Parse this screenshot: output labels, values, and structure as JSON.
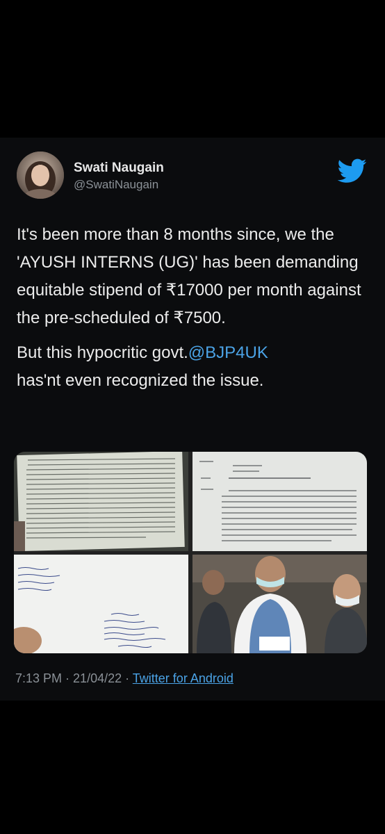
{
  "user": {
    "display_name": "Swati Naugain",
    "handle": "@SwatiNaugain",
    "avatar_icon": "profile-photo"
  },
  "tweet": {
    "paragraph_1": "It's been more than 8 months since, we the 'AYUSH INTERNS (UG)' has been demanding equitable stipend of ₹17000 per month against the pre-scheduled of ₹7500.",
    "paragraph_2_prefix": "But this hypocritic govt.",
    "mention": "@BJP4UK",
    "paragraph_2_suffix": "has'nt even recognized the issue."
  },
  "media": [
    {
      "name": "photo-hindi-letter-page",
      "kind": "document-photo"
    },
    {
      "name": "photo-hindi-letter-header",
      "kind": "document-photo"
    },
    {
      "name": "photo-handwritten-address-envelope",
      "kind": "document-photo"
    },
    {
      "name": "photo-officials-reading-letter",
      "kind": "people-photo"
    }
  ],
  "meta": {
    "time": "7:13 PM",
    "separator": " · ",
    "date": "21/04/22",
    "source": "Twitter for Android"
  },
  "colors": {
    "background": "#000000",
    "card": "#0b0c0e",
    "text": "#ececec",
    "secondary": "#8b9197",
    "link": "#4ba3e6",
    "twitter_blue": "#1d9bf0"
  }
}
